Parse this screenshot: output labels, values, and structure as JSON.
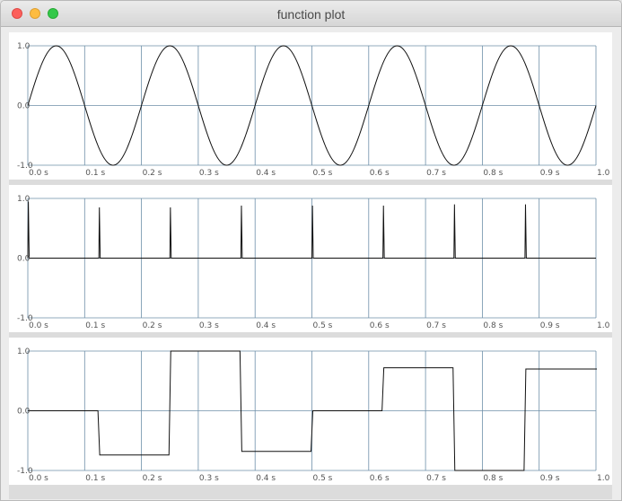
{
  "window": {
    "title": "function plot"
  },
  "colors": {
    "grid": "#6e8fa9",
    "trace": "#111111",
    "panel_bg": "#ffffff"
  },
  "chart_data": [
    {
      "type": "line",
      "xlim": [
        0,
        1
      ],
      "ylim": [
        -1,
        1
      ],
      "x_ticks": [
        "0.0 s",
        "0.1 s",
        "0.2 s",
        "0.3 s",
        "0.4 s",
        "0.5 s",
        "0.6 s",
        "0.7 s",
        "0.8 s",
        "0.9 s",
        "1.0"
      ],
      "y_ticks": [
        "1.0",
        "0.0",
        "-1.0"
      ],
      "grid": true,
      "series": [
        {
          "x": [
            0,
            0.05,
            0.1,
            0.15,
            0.2,
            0.25,
            0.3,
            0.35,
            0.4,
            0.45,
            0.5,
            0.55,
            0.6,
            0.65,
            0.7,
            0.75,
            0.8,
            0.85,
            0.9,
            0.95,
            1.0
          ],
          "y": [
            0,
            1,
            0,
            -1,
            0,
            1,
            0,
            -1,
            0,
            1,
            0,
            -1,
            0,
            1,
            0,
            -1,
            0,
            1,
            0,
            -1,
            0
          ]
        }
      ]
    },
    {
      "type": "line",
      "xlim": [
        0,
        1
      ],
      "ylim": [
        -1,
        1
      ],
      "x_ticks": [
        "0.0 s",
        "0.1 s",
        "0.2 s",
        "0.3 s",
        "0.4 s",
        "0.5 s",
        "0.6 s",
        "0.7 s",
        "0.8 s",
        "0.9 s",
        "1.0"
      ],
      "y_ticks": [
        "1.0",
        "0.0",
        "-1.0"
      ],
      "grid": true,
      "series": [
        {
          "x": [
            0,
            0.125,
            0.25,
            0.375,
            0.5,
            0.625,
            0.75,
            0.875
          ],
          "y": [
            0.95,
            0.85,
            0.85,
            0.88,
            0.88,
            0.88,
            0.9,
            0.9
          ]
        }
      ]
    },
    {
      "type": "line",
      "xlim": [
        0,
        1
      ],
      "ylim": [
        -1,
        1
      ],
      "x_ticks": [
        "0.0 s",
        "0.1 s",
        "0.2 s",
        "0.3 s",
        "0.4 s",
        "0.5 s",
        "0.6 s",
        "0.7 s",
        "0.8 s",
        "0.9 s",
        "1.0"
      ],
      "y_ticks": [
        "1.0",
        "0.0",
        "-1.0"
      ],
      "grid": true,
      "series": [
        {
          "x": [
            0,
            0.125,
            0.25,
            0.375,
            0.5,
            0.625,
            0.75,
            0.875,
            1.0
          ],
          "y": [
            0.0,
            -0.74,
            1.0,
            -0.68,
            0.0,
            0.72,
            -1.0,
            0.7,
            0.7
          ]
        }
      ]
    }
  ]
}
